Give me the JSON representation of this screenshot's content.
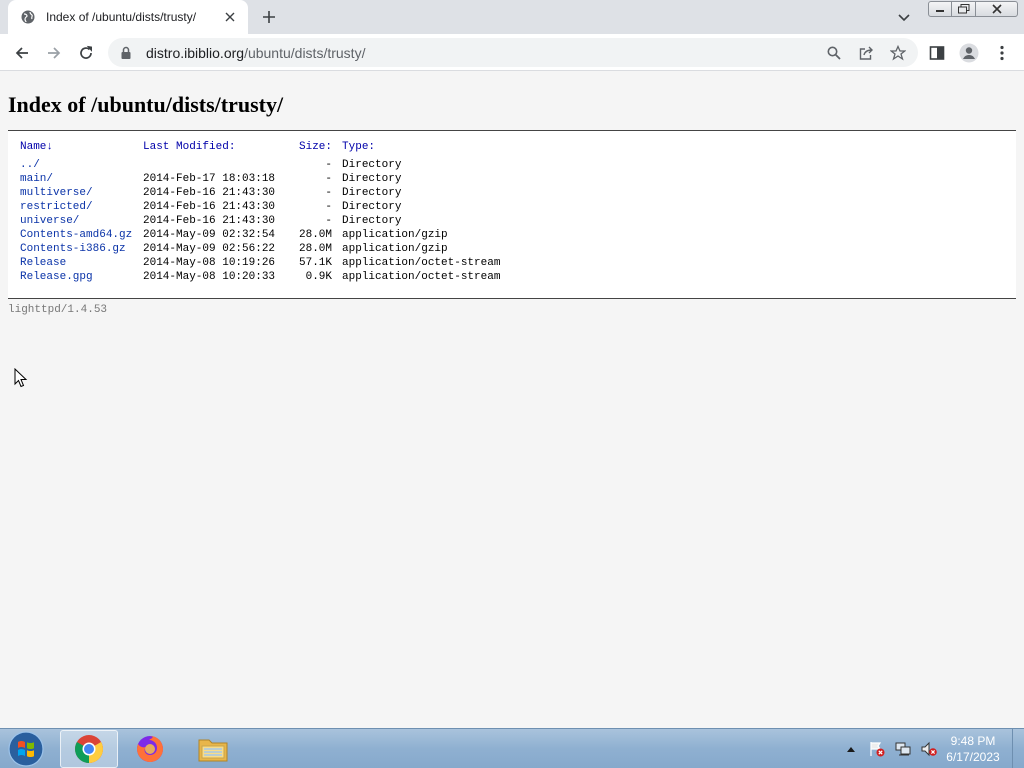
{
  "browser": {
    "tab_title": "Index of /ubuntu/dists/trusty/",
    "url_host": "distro.ibiblio.org",
    "url_path": "/ubuntu/dists/trusty/"
  },
  "page": {
    "title": "Index of /ubuntu/dists/trusty/",
    "columns": {
      "name": "Name↓",
      "modified": "Last Modified:",
      "size": "Size:",
      "type": "Type:"
    },
    "rows": [
      {
        "name": "../",
        "modified": "",
        "size": "-",
        "type": "Directory"
      },
      {
        "name": "main/",
        "modified": "2014-Feb-17 18:03:18",
        "size": "-",
        "type": "Directory"
      },
      {
        "name": "multiverse/",
        "modified": "2014-Feb-16 21:43:30",
        "size": "-",
        "type": "Directory"
      },
      {
        "name": "restricted/",
        "modified": "2014-Feb-16 21:43:30",
        "size": "-",
        "type": "Directory"
      },
      {
        "name": "universe/",
        "modified": "2014-Feb-16 21:43:30",
        "size": "-",
        "type": "Directory"
      },
      {
        "name": "Contents-amd64.gz",
        "modified": "2014-May-09 02:32:54",
        "size": "28.0M",
        "type": "application/gzip"
      },
      {
        "name": "Contents-i386.gz",
        "modified": "2014-May-09 02:56:22",
        "size": "28.0M",
        "type": "application/gzip"
      },
      {
        "name": "Release",
        "modified": "2014-May-08 10:19:26",
        "size": "57.1K",
        "type": "application/octet-stream"
      },
      {
        "name": "Release.gpg",
        "modified": "2014-May-08 10:20:33",
        "size": "0.9K",
        "type": "application/octet-stream"
      }
    ],
    "footer": "lighttpd/1.4.53"
  },
  "taskbar": {
    "time": "9:48 PM",
    "date": "6/17/2023"
  },
  "icons": {
    "tab_favicon": "globe-icon",
    "tab_close": "close-icon",
    "new_tab": "plus-icon",
    "back": "arrow-left-icon",
    "forward": "arrow-right-icon",
    "reload": "reload-icon",
    "lock": "lock-icon",
    "zoom": "search-icon",
    "share": "share-icon",
    "bookmark": "star-icon",
    "side_panel": "side-panel-icon",
    "profile": "profile-icon",
    "menu": "kebab-menu-icon"
  },
  "colors": {
    "link": "#0a33a8",
    "header": "#0000aa",
    "footer_text": "#777777"
  }
}
